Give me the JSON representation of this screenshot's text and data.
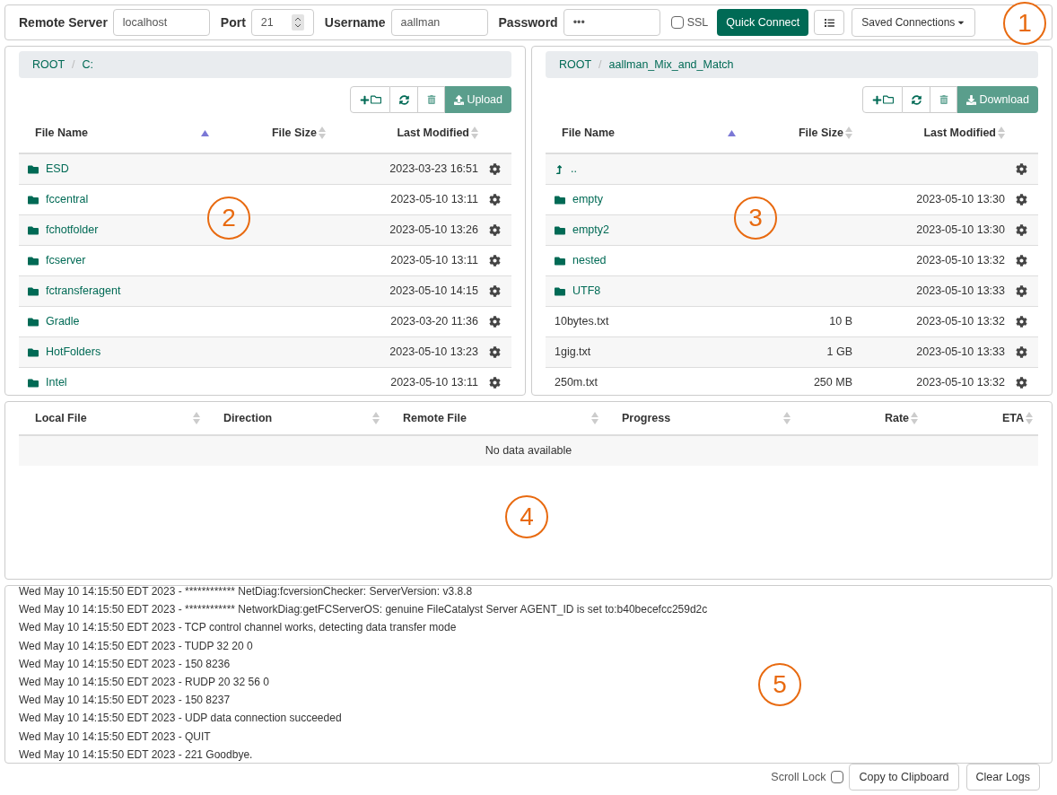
{
  "connect_bar": {
    "server_label": "Remote Server",
    "server_value": "localhost",
    "port_label": "Port",
    "port_value": "21",
    "username_label": "Username",
    "username_value": "aallman",
    "password_label": "Password",
    "password_value": "•••",
    "ssl_label": "SSL",
    "ssl_checked": false,
    "quick_connect": "Quick Connect",
    "saved_connections": "Saved Connections",
    "callout": "1"
  },
  "local_panel": {
    "breadcrumb": [
      "ROOT",
      "C:"
    ],
    "separator": "/",
    "action": "Upload",
    "callout": "2",
    "columns": [
      {
        "label": "File Name",
        "sorted": true
      },
      {
        "label": "File Size",
        "sorted": false
      },
      {
        "label": "Last Modified",
        "sorted": false
      }
    ],
    "rows": [
      {
        "kind": "folder",
        "name": "ESD",
        "modified": "2023-03-23 16:51"
      },
      {
        "kind": "folder",
        "name": "fccentral",
        "modified": "2023-05-10 13:11"
      },
      {
        "kind": "folder",
        "name": "fchotfolder",
        "modified": "2023-05-10 13:26"
      },
      {
        "kind": "folder",
        "name": "fcserver",
        "modified": "2023-05-10 13:11"
      },
      {
        "kind": "folder",
        "name": "fctransferagent",
        "modified": "2023-05-10 14:15"
      },
      {
        "kind": "folder",
        "name": "Gradle",
        "modified": "2023-03-20 11:36"
      },
      {
        "kind": "folder",
        "name": "HotFolders",
        "modified": "2023-05-10 13:23"
      },
      {
        "kind": "folder",
        "name": "Intel",
        "modified": "2023-05-10 13:11"
      }
    ]
  },
  "remote_panel": {
    "breadcrumb": [
      "ROOT",
      "aallman_Mix_and_Match"
    ],
    "separator": "/",
    "action": "Download",
    "callout": "3",
    "columns": [
      {
        "label": "File Name",
        "sorted": true
      },
      {
        "label": "File Size",
        "sorted": false
      },
      {
        "label": "Last Modified",
        "sorted": false
      }
    ],
    "rows": [
      {
        "kind": "parent",
        "name": ".."
      },
      {
        "kind": "folder",
        "name": "empty",
        "modified": "2023-05-10 13:30"
      },
      {
        "kind": "folder",
        "name": "empty2",
        "modified": "2023-05-10 13:30"
      },
      {
        "kind": "folder",
        "name": "nested",
        "modified": "2023-05-10 13:32"
      },
      {
        "kind": "folder",
        "name": "UTF8",
        "modified": "2023-05-10 13:33"
      },
      {
        "kind": "file",
        "name": "10bytes.txt",
        "size": "10 B",
        "modified": "2023-05-10 13:32"
      },
      {
        "kind": "file",
        "name": "1gig.txt",
        "size": "1 GB",
        "modified": "2023-05-10 13:33"
      },
      {
        "kind": "file",
        "name": "250m.txt",
        "size": "250 MB",
        "modified": "2023-05-10 13:32"
      }
    ]
  },
  "transfers": {
    "columns": [
      "Local File",
      "Direction",
      "Remote File",
      "Progress",
      "Rate",
      "ETA"
    ],
    "empty_message": "No data available",
    "callout": "4"
  },
  "log": {
    "lines": [
      "Wed May 10 14:15:50 EDT 2023 - ************ NetDiag:fcversionChecker: ServerVersion: v3.8.8",
      "Wed May 10 14:15:50 EDT 2023 - ************ NetworkDiag:getFCServerOS: genuine FileCatalyst Server AGENT_ID is set to:b40becefcc259d2c",
      "Wed May 10 14:15:50 EDT 2023 - TCP control channel works, detecting data transfer mode",
      "Wed May 10 14:15:50 EDT 2023 - TUDP 32 20 0",
      "Wed May 10 14:15:50 EDT 2023 - 150 8236",
      "Wed May 10 14:15:50 EDT 2023 - RUDP 20 32 56 0",
      "Wed May 10 14:15:50 EDT 2023 - 150 8237",
      "Wed May 10 14:15:50 EDT 2023 - UDP data connection succeeded",
      "Wed May 10 14:15:50 EDT 2023 - QUIT",
      "Wed May 10 14:15:50 EDT 2023 - 221 Goodbye."
    ],
    "callout": "5",
    "scroll_lock_label": "Scroll Lock",
    "scroll_lock_checked": false,
    "copy_button": "Copy to Clipboard",
    "clear_button": "Clear Logs"
  }
}
